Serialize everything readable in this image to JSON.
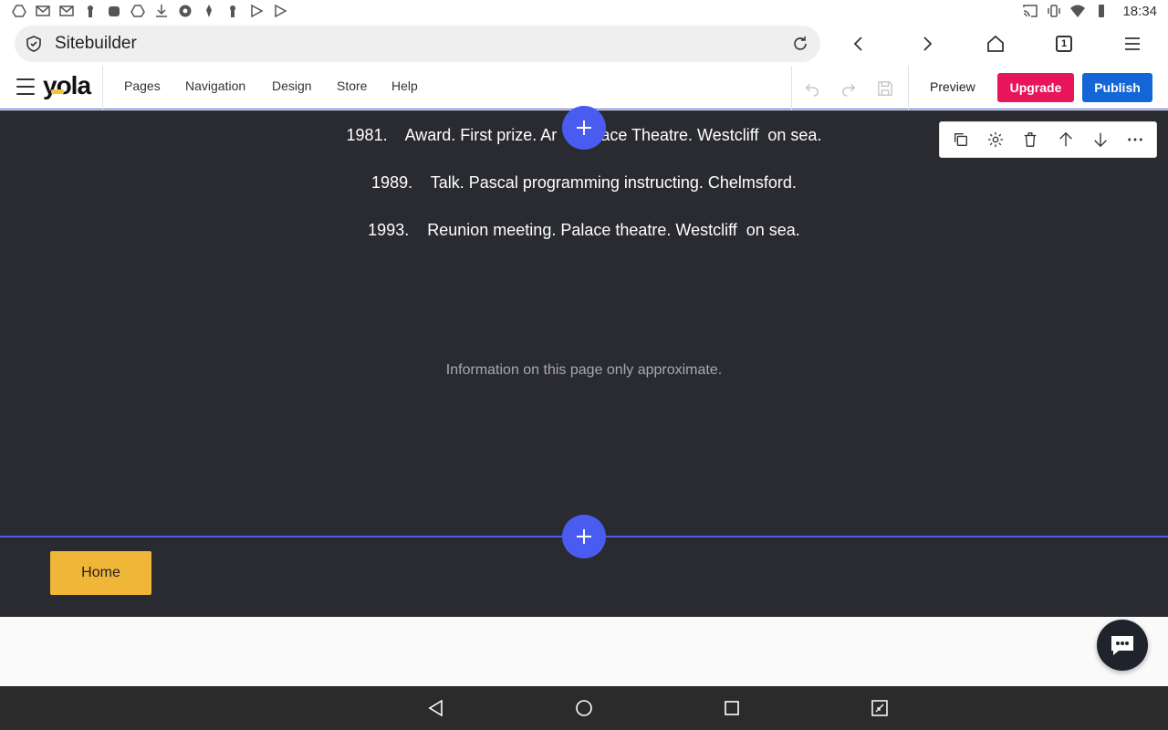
{
  "status_bar": {
    "time": "18:34",
    "left_icons": [
      "drive-icon",
      "gmail-icon",
      "gmail-icon",
      "keyhole-icon",
      "android-icon",
      "drive-icon",
      "download-icon",
      "aperture-icon",
      "pin-icon",
      "keyhole-icon",
      "play-store-icon",
      "play-store-icon"
    ],
    "right_icons": [
      "cast-icon",
      "vibrate-icon",
      "wifi-icon",
      "battery-icon"
    ]
  },
  "browser": {
    "url_title": "Sitebuilder",
    "tab_count": "1"
  },
  "editor": {
    "logo": "yola",
    "menu": [
      "Pages",
      "Navigation",
      "Design",
      "Store",
      "Help"
    ],
    "preview_label": "Preview",
    "upgrade_label": "Upgrade",
    "publish_label": "Publish"
  },
  "content": {
    "events": [
      {
        "year": "1981.",
        "text": "Award. First prize. Ar",
        "text_after": "ace Theatre. Westcliff  on sea."
      },
      {
        "year": "1989.",
        "text": "Talk. Pascal programming instructing. Chelmsford."
      },
      {
        "year": "1993.",
        "text": "Reunion meeting. Palace theatre. Westcliff  on sea."
      }
    ],
    "note": "Information on this page only approximate.",
    "footer_button": "Home"
  },
  "colors": {
    "accent": "#4a5cf0",
    "upgrade": "#e8145c",
    "publish": "#1266d8",
    "home_button": "#f0b638",
    "canvas_bg": "#2a2b30"
  }
}
